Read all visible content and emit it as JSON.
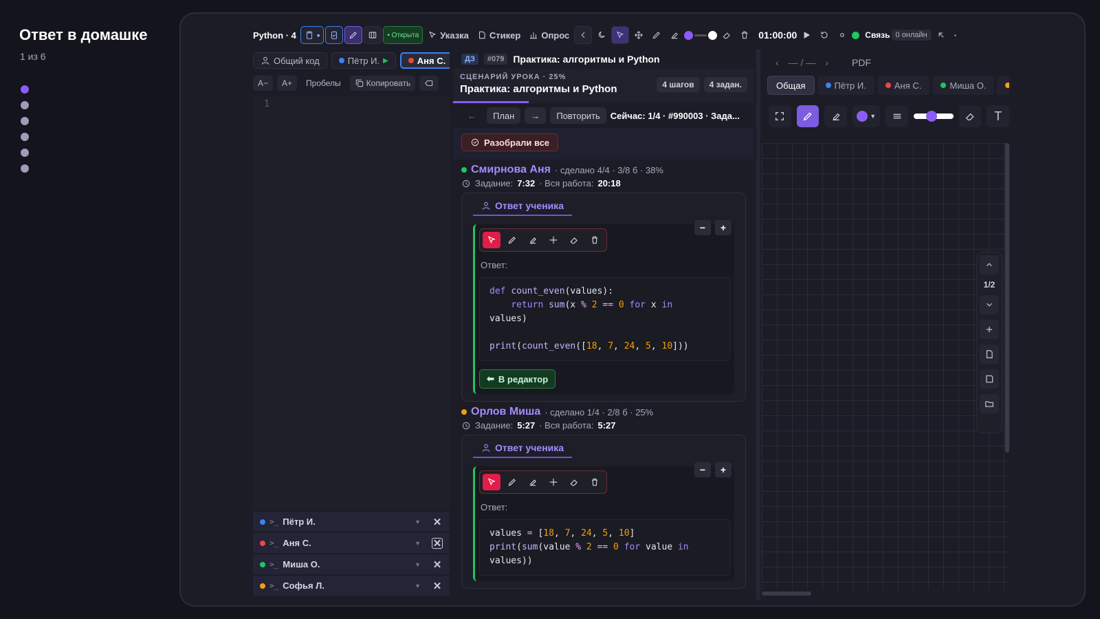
{
  "slide": {
    "title": "Ответ в домашке",
    "counter": "1 из 6",
    "dots": 6,
    "active_dot": 0
  },
  "toolbar": {
    "title": "Python · 4",
    "status": "• Открыта",
    "pointer": "Указка",
    "sticker": "Стикер",
    "poll": "Опрос",
    "timer": "01:00:00",
    "connection": "Связь",
    "online": "0 онлайн"
  },
  "code_panel": {
    "tabs": [
      {
        "label": "Общий код",
        "color": ""
      },
      {
        "label": "Пётр И.",
        "color": "#3b82f6"
      },
      {
        "label": "Аня С.",
        "color": "#ef4444"
      }
    ],
    "font_minus": "A−",
    "font_plus": "A+",
    "spaces": "Пробелы",
    "copy": "Копировать",
    "line_number": "1",
    "sessions": [
      {
        "name": "Пётр И.",
        "color": "#3b82f6"
      },
      {
        "name": "Аня С.",
        "color": "#ef4444"
      },
      {
        "name": "Миша О.",
        "color": "#22c55e"
      },
      {
        "name": "Софья Л.",
        "color": "#f59e0b"
      }
    ]
  },
  "homework": {
    "badge": "ДЗ",
    "number": "#079",
    "title": "Практика: алгоритмы и Python",
    "scenario_label": "СЦЕНАРИЙ УРОКА · 25%",
    "scenario_title": "Практика: алгоритмы и Python",
    "steps": "4 шагов",
    "tasks": "4 задан.",
    "progress": 25,
    "plan": "План",
    "repeat": "Повторить",
    "now": "Сейчас: 1/4 · #990003 · Зада...",
    "reviewed_all": "Разобрали все"
  },
  "students": [
    {
      "name": "Смирнова Аня",
      "status_color": "#22c55e",
      "stats": "· сделано 4/4 · 3/8 б · 38%",
      "task_label": "Задание:",
      "task_time": "7:32",
      "total_label": "· Вся работа:",
      "total_time": "20:18",
      "tab": "Ответ ученика",
      "answer_label": "Ответ:",
      "to_editor": "В редактор"
    },
    {
      "name": "Орлов Миша",
      "status_color": "#f59e0b",
      "stats": "· сделано 1/4 · 2/8 б · 25%",
      "task_label": "Задание:",
      "task_time": "5:27",
      "total_label": "· Вся работа:",
      "total_time": "5:27",
      "tab": "Ответ ученика",
      "answer_label": "Ответ:"
    }
  ],
  "whiteboard": {
    "pages_nav": "— / —",
    "pdf": "PDF",
    "tabs": [
      {
        "label": "Общая",
        "color": ""
      },
      {
        "label": "Пётр И.",
        "color": "#3b82f6"
      },
      {
        "label": "Аня С.",
        "color": "#ef4444"
      },
      {
        "label": "Миша О.",
        "color": "#22c55e"
      }
    ],
    "page": "1/2",
    "pen_color": "#8b5cf6"
  }
}
